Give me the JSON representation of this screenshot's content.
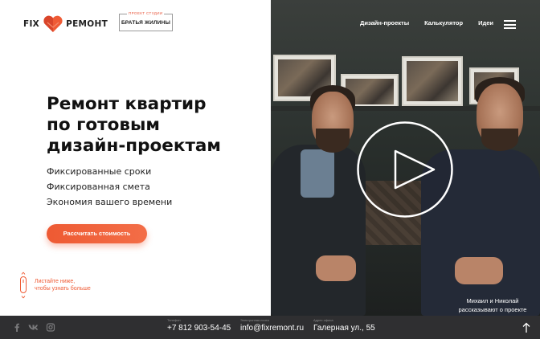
{
  "header": {
    "logo_word_left": "FIX",
    "logo_word_right": "РЕМОНТ",
    "studio_badge_sup": "ПРОЕКТ СТУДИИ",
    "studio_badge_name": "БРАТЬЯ ЖИЛИНЫ",
    "nav": [
      {
        "label": "Дизайн-проекты"
      },
      {
        "label": "Калькулятор"
      },
      {
        "label": "Идеи"
      }
    ]
  },
  "hero": {
    "title_lines": [
      "Ремонт квартир",
      "по готовым",
      "дизайн-проектам"
    ],
    "features": [
      "Фиксированные сроки",
      "Фиксированная смета",
      "Экономия вашего времени"
    ],
    "cta_label": "Рассчитать стоимость",
    "scroll_hint_lines": [
      "Листайте ниже,",
      "чтобы узнать больше"
    ]
  },
  "video": {
    "caption_lines": [
      "Михаил и Николай",
      "рассказывают о проекте"
    ]
  },
  "footer": {
    "phone_label": "Телефон",
    "phone": "+7 812 903-54-45",
    "email_label": "Электронная почта",
    "email": "info@fixremont.ru",
    "address_label": "Адрес офиса",
    "address": "Галерная ул., 55",
    "social": [
      {
        "icon": "facebook-icon"
      },
      {
        "icon": "vk-icon"
      },
      {
        "icon": "instagram-icon"
      }
    ]
  },
  "colors": {
    "accent": "#ef5b35",
    "footer_bg": "#2f2f31",
    "text_dark": "#111111"
  }
}
